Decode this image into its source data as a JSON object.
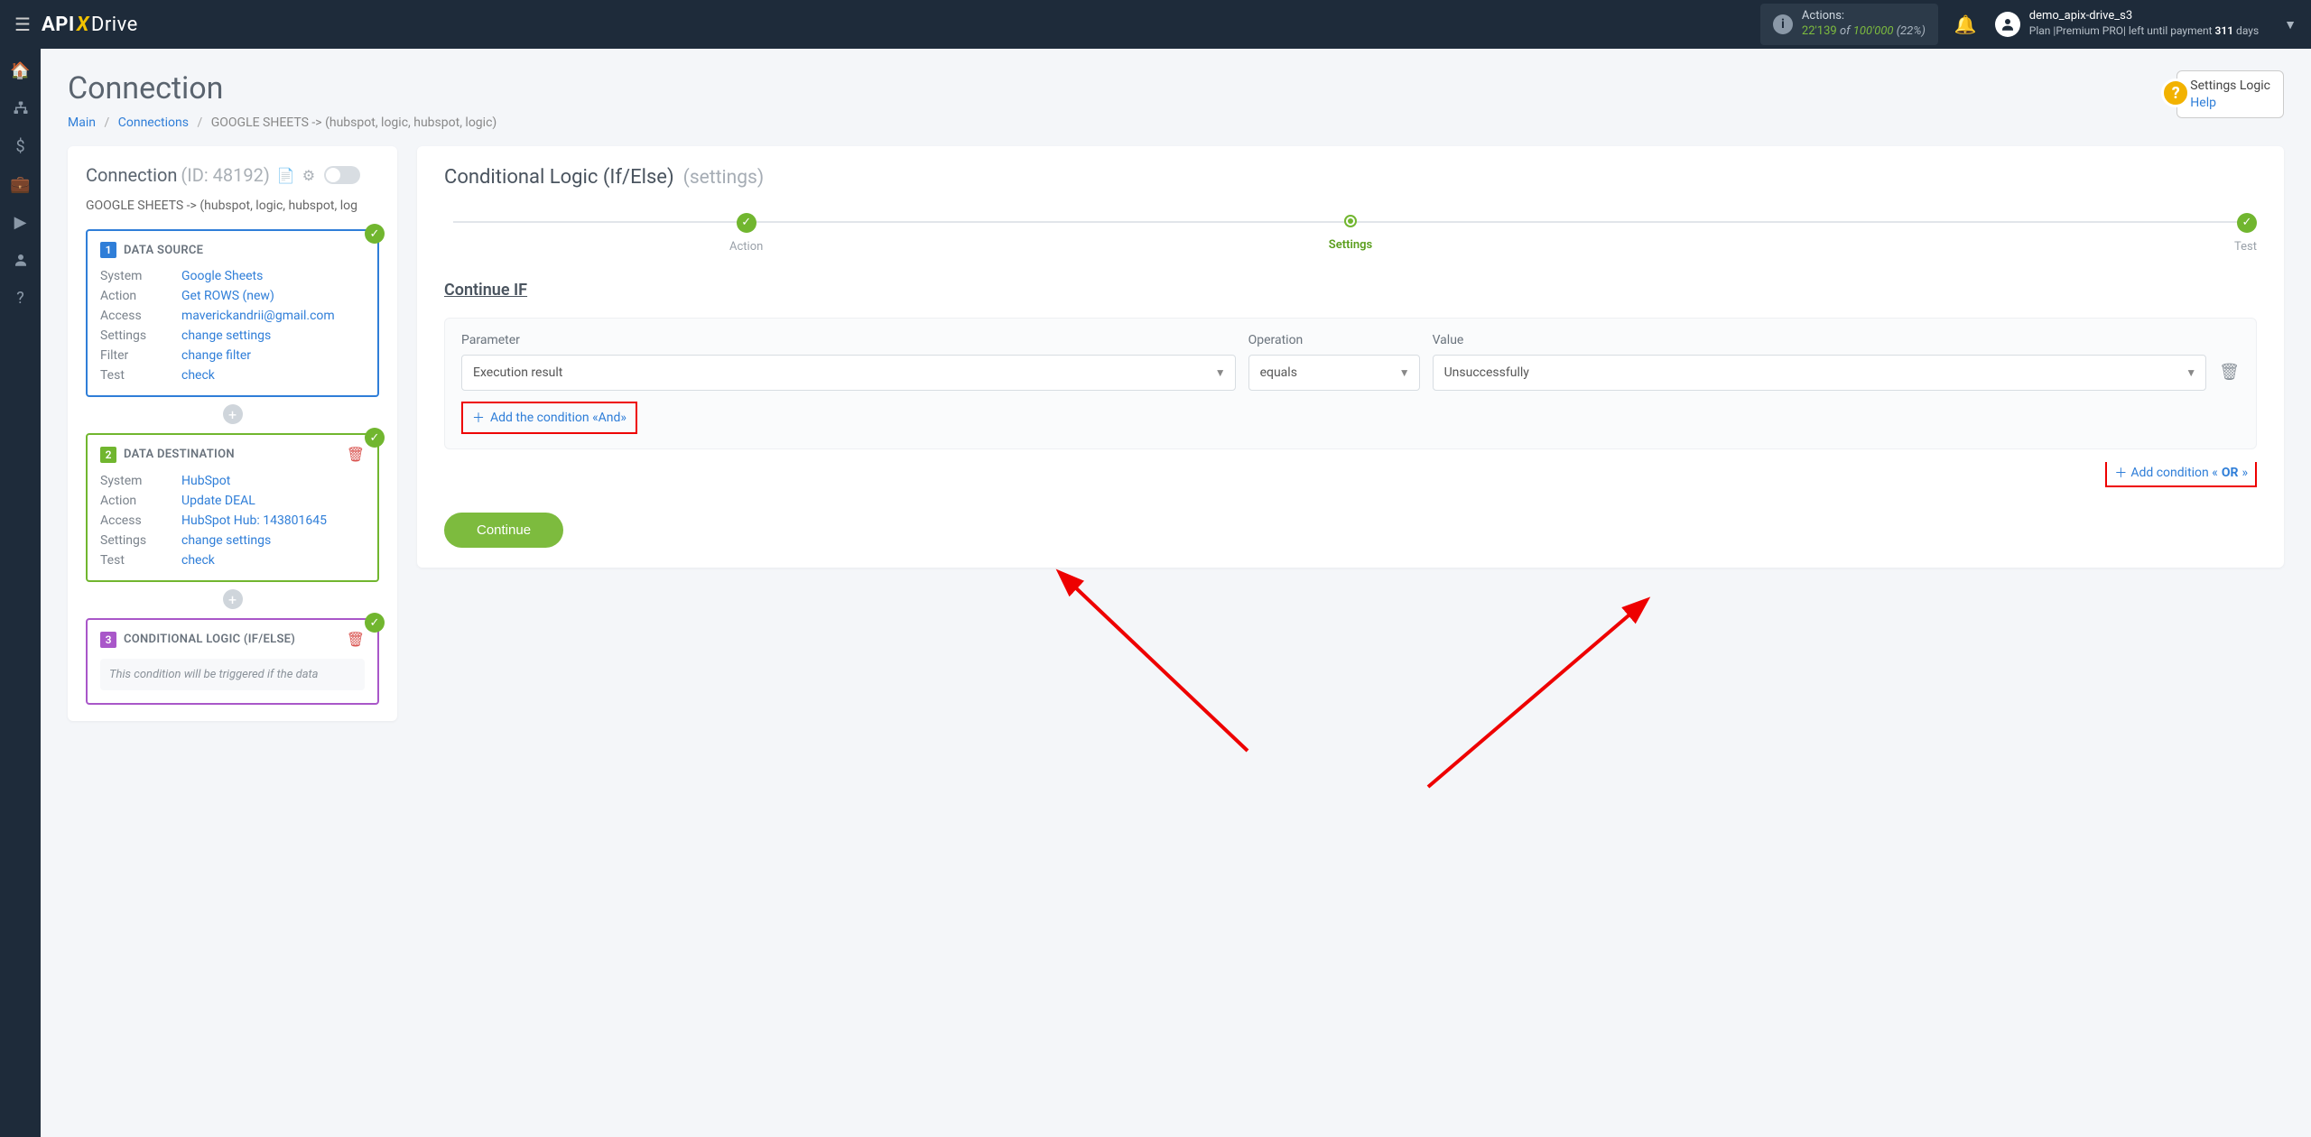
{
  "topbar": {
    "logo_api": "API",
    "logo_drive": "Drive",
    "actions_label": "Actions:",
    "actions_used": "22'139",
    "actions_of": "of",
    "actions_total": "100'000",
    "actions_pct": "(22%)",
    "username": "demo_apix-drive_s3",
    "plan_text": "Plan |Premium PRO| left until payment ",
    "plan_days": "311",
    "plan_days_suffix": " days"
  },
  "page": {
    "title": "Connection",
    "bc_main": "Main",
    "bc_conn": "Connections",
    "bc_current": "GOOGLE SHEETS -> (hubspot, logic, hubspot, logic)",
    "help_title": "Settings Logic",
    "help_link": "Help"
  },
  "left": {
    "title": "Connection",
    "id_label": "(ID: 48192)",
    "subtitle": "GOOGLE SHEETS -> (hubspot, logic, hubspot, log",
    "block1": {
      "title": "DATA SOURCE",
      "rows": [
        {
          "k": "System",
          "v": "Google Sheets"
        },
        {
          "k": "Action",
          "v": "Get ROWS (new)"
        },
        {
          "k": "Access",
          "v": "maverickandrii@gmail.com"
        },
        {
          "k": "Settings",
          "v": "change settings"
        },
        {
          "k": "Filter",
          "v": "change filter"
        },
        {
          "k": "Test",
          "v": "check"
        }
      ]
    },
    "block2": {
      "title": "DATA DESTINATION",
      "rows": [
        {
          "k": "System",
          "v": "HubSpot"
        },
        {
          "k": "Action",
          "v": "Update DEAL"
        },
        {
          "k": "Access",
          "v": "HubSpot Hub: 143801645"
        },
        {
          "k": "Settings",
          "v": "change settings"
        },
        {
          "k": "Test",
          "v": "check"
        }
      ]
    },
    "block3": {
      "title": "CONDITIONAL LOGIC (IF/ELSE)",
      "note": "This condition will be triggered if the data"
    }
  },
  "right": {
    "title": "Conditional Logic (If/Else)",
    "subtitle": "(settings)",
    "step_action": "Action",
    "step_settings": "Settings",
    "step_test": "Test",
    "section": "Continue IF",
    "labels": {
      "parameter": "Parameter",
      "operation": "Operation",
      "value": "Value"
    },
    "values": {
      "parameter": "Execution result",
      "operation": "equals",
      "value": "Unsuccessfully"
    },
    "add_and": "Add the condition «And»",
    "add_or_prefix": "Add condition «",
    "add_or_bold": "OR",
    "add_or_suffix": "»",
    "continue": "Continue"
  }
}
